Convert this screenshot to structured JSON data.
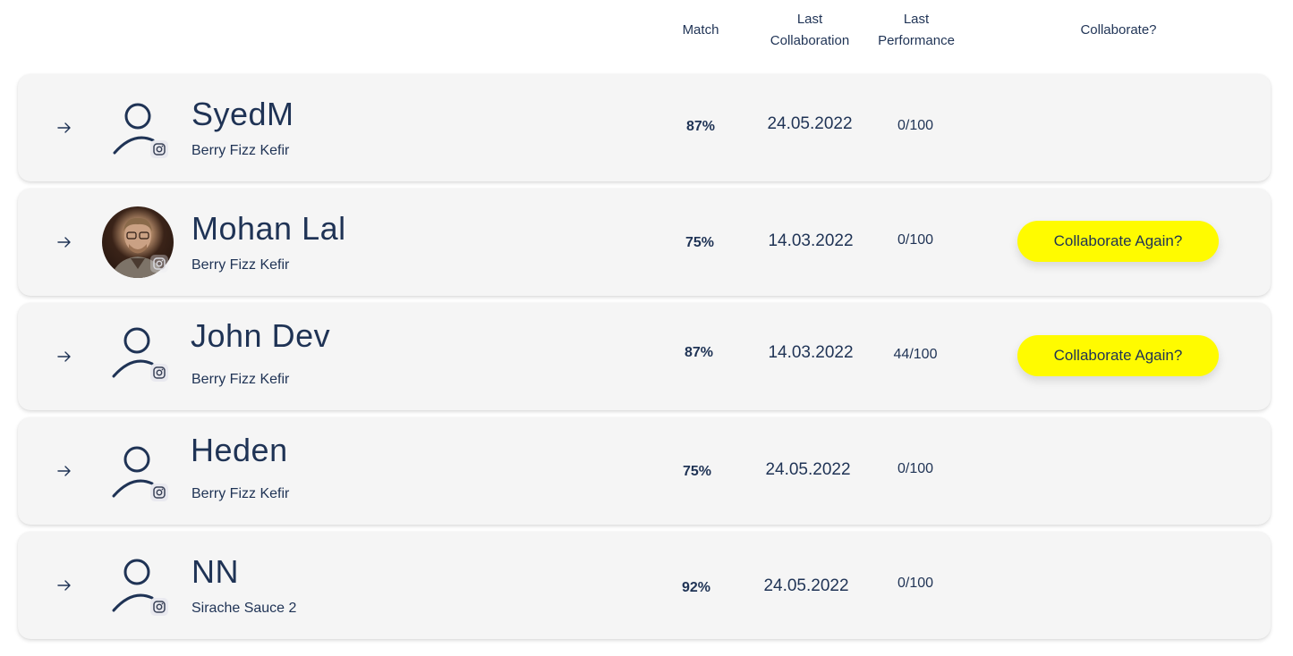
{
  "header": {
    "match": "Match",
    "last_collaboration": "Last\nCollaboration",
    "last_performance": "Last\nPerformance",
    "collaborate": "Collaborate?"
  },
  "rows": [
    {
      "name": "SyedM",
      "product": "Berry Fizz Kefir",
      "match": "87%",
      "date": "24.05.2022",
      "performance": "0/100",
      "avatar": "placeholder-person-icon",
      "button": ""
    },
    {
      "name": "Mohan Lal",
      "product": "Berry Fizz Kefir",
      "match": "75%",
      "date": "14.03.2022",
      "performance": "0/100",
      "avatar": "photo",
      "button": "Collaborate Again?"
    },
    {
      "name": "John Dev",
      "product": "Berry Fizz Kefir",
      "match": "87%",
      "date": "14.03.2022",
      "performance": "44/100",
      "avatar": "placeholder-person-icon",
      "button": "Collaborate Again?"
    },
    {
      "name": "Heden",
      "product": "Berry Fizz Kefir",
      "match": "75%",
      "date": "24.05.2022",
      "performance": "0/100",
      "avatar": "placeholder-person-icon",
      "button": ""
    },
    {
      "name": "NN",
      "product": "Sirache Sauce 2",
      "match": "92%",
      "date": "24.05.2022",
      "performance": "0/100",
      "avatar": "placeholder-person-icon",
      "button": ""
    }
  ],
  "colors": {
    "text": "#1f3355",
    "row_bg": "#f5f5f5",
    "button_bg": "#fffb00"
  },
  "icons": {
    "row_arrow": "arrow-right-icon",
    "badge": "instagram-icon"
  }
}
